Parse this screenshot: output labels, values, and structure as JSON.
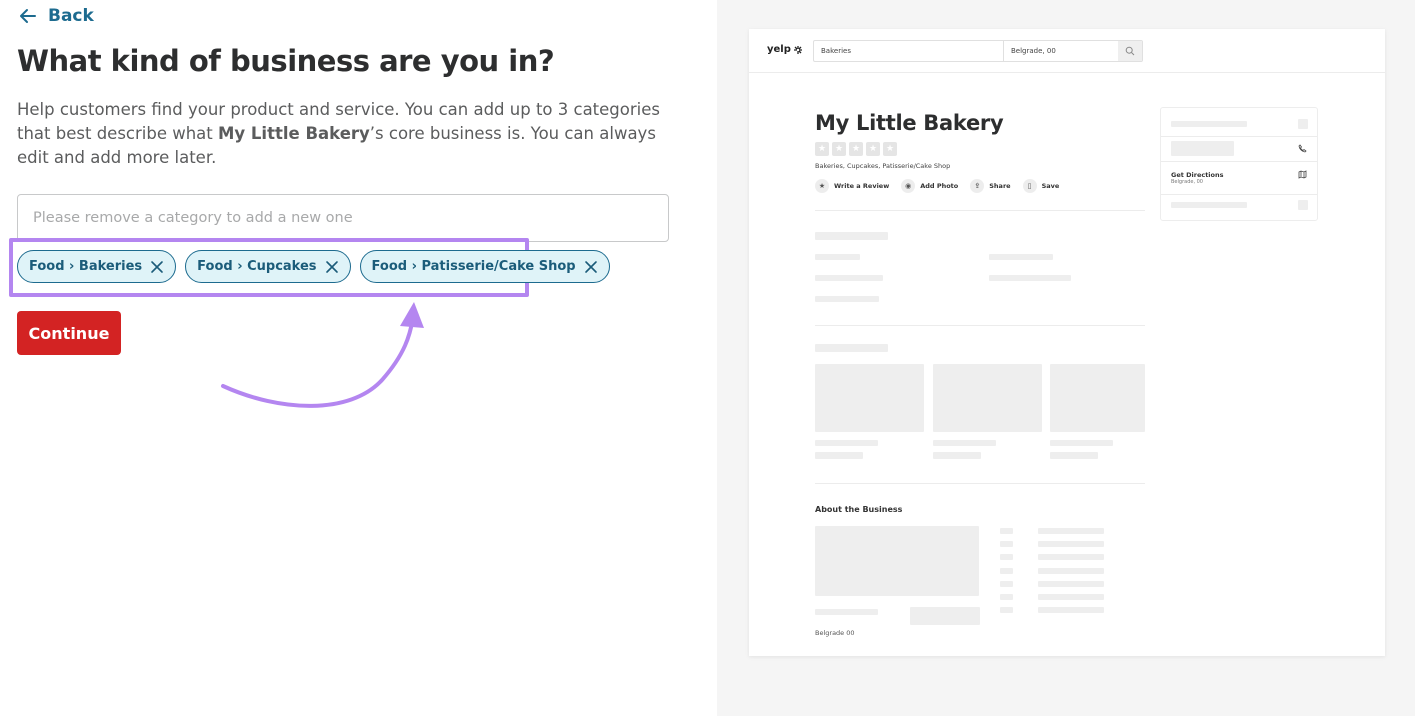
{
  "back_label": "Back",
  "title": "What kind of business are you in?",
  "description": {
    "part1": "Help customers find your product and service. You can add up to 3 categories that best describe what ",
    "business_name": "My Little Bakery",
    "part2": "’s core business is. You can always edit and add more later."
  },
  "category_input": {
    "placeholder": "Please remove a category to add a new one",
    "value": ""
  },
  "chips": [
    {
      "label": "Food › Bakeries"
    },
    {
      "label": "Food › Cupcakes"
    },
    {
      "label": "Food › Patisserie/Cake Shop"
    }
  ],
  "continue_label": "Continue",
  "colors": {
    "accent_red": "#d32323",
    "chip_border": "#1d6b8f",
    "chip_bg": "#dff3f8",
    "highlight": "#b486f0"
  },
  "preview": {
    "logo": "yelp",
    "search_find": "Bakeries",
    "search_near": "Belgrade, 00",
    "business_name": "My Little Bakery",
    "categories": "Bakeries, Cupcakes, Patisserie/Cake Shop",
    "actions": [
      "Write a Review",
      "Add Photo",
      "Share",
      "Save"
    ],
    "directions_title": "Get Directions",
    "directions_sub": "Belgrade, 00",
    "about_title": "About the Business",
    "location": "Belgrade 00"
  }
}
